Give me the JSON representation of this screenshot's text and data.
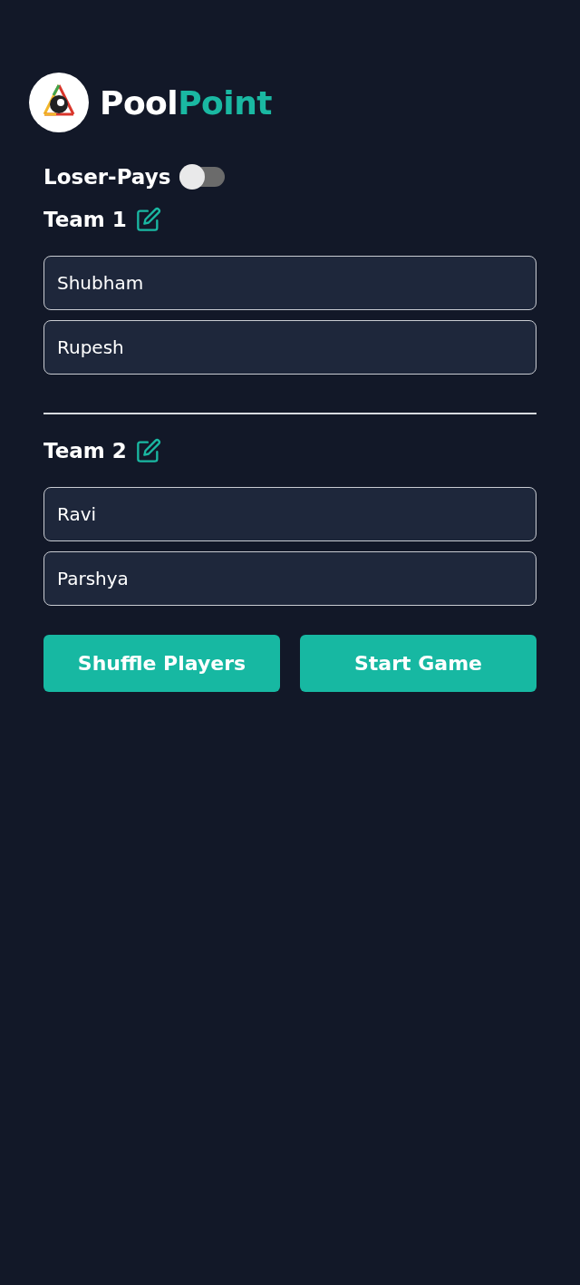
{
  "brand": {
    "first": "Pool",
    "second": "Point"
  },
  "loser_pays": {
    "label": "Loser-Pays",
    "on": false
  },
  "teams": [
    {
      "name": "Team 1",
      "players": [
        {
          "value": "Shubham"
        },
        {
          "value": "Rupesh"
        }
      ]
    },
    {
      "name": "Team 2",
      "players": [
        {
          "value": "Ravi"
        },
        {
          "value": "Parshya"
        }
      ]
    }
  ],
  "buttons": [
    "Shuffle Players",
    "Start Game"
  ]
}
